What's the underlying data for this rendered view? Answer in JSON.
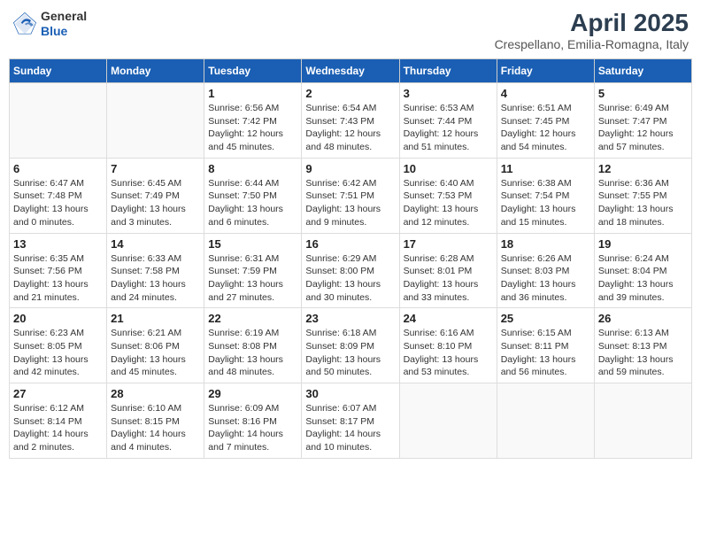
{
  "header": {
    "logo_general": "General",
    "logo_blue": "Blue",
    "title": "April 2025",
    "subtitle": "Crespellano, Emilia-Romagna, Italy"
  },
  "weekdays": [
    "Sunday",
    "Monday",
    "Tuesday",
    "Wednesday",
    "Thursday",
    "Friday",
    "Saturday"
  ],
  "weeks": [
    [
      {
        "day": null
      },
      {
        "day": null
      },
      {
        "day": "1",
        "sunrise": "Sunrise: 6:56 AM",
        "sunset": "Sunset: 7:42 PM",
        "daylight": "Daylight: 12 hours and 45 minutes."
      },
      {
        "day": "2",
        "sunrise": "Sunrise: 6:54 AM",
        "sunset": "Sunset: 7:43 PM",
        "daylight": "Daylight: 12 hours and 48 minutes."
      },
      {
        "day": "3",
        "sunrise": "Sunrise: 6:53 AM",
        "sunset": "Sunset: 7:44 PM",
        "daylight": "Daylight: 12 hours and 51 minutes."
      },
      {
        "day": "4",
        "sunrise": "Sunrise: 6:51 AM",
        "sunset": "Sunset: 7:45 PM",
        "daylight": "Daylight: 12 hours and 54 minutes."
      },
      {
        "day": "5",
        "sunrise": "Sunrise: 6:49 AM",
        "sunset": "Sunset: 7:47 PM",
        "daylight": "Daylight: 12 hours and 57 minutes."
      }
    ],
    [
      {
        "day": "6",
        "sunrise": "Sunrise: 6:47 AM",
        "sunset": "Sunset: 7:48 PM",
        "daylight": "Daylight: 13 hours and 0 minutes."
      },
      {
        "day": "7",
        "sunrise": "Sunrise: 6:45 AM",
        "sunset": "Sunset: 7:49 PM",
        "daylight": "Daylight: 13 hours and 3 minutes."
      },
      {
        "day": "8",
        "sunrise": "Sunrise: 6:44 AM",
        "sunset": "Sunset: 7:50 PM",
        "daylight": "Daylight: 13 hours and 6 minutes."
      },
      {
        "day": "9",
        "sunrise": "Sunrise: 6:42 AM",
        "sunset": "Sunset: 7:51 PM",
        "daylight": "Daylight: 13 hours and 9 minutes."
      },
      {
        "day": "10",
        "sunrise": "Sunrise: 6:40 AM",
        "sunset": "Sunset: 7:53 PM",
        "daylight": "Daylight: 13 hours and 12 minutes."
      },
      {
        "day": "11",
        "sunrise": "Sunrise: 6:38 AM",
        "sunset": "Sunset: 7:54 PM",
        "daylight": "Daylight: 13 hours and 15 minutes."
      },
      {
        "day": "12",
        "sunrise": "Sunrise: 6:36 AM",
        "sunset": "Sunset: 7:55 PM",
        "daylight": "Daylight: 13 hours and 18 minutes."
      }
    ],
    [
      {
        "day": "13",
        "sunrise": "Sunrise: 6:35 AM",
        "sunset": "Sunset: 7:56 PM",
        "daylight": "Daylight: 13 hours and 21 minutes."
      },
      {
        "day": "14",
        "sunrise": "Sunrise: 6:33 AM",
        "sunset": "Sunset: 7:58 PM",
        "daylight": "Daylight: 13 hours and 24 minutes."
      },
      {
        "day": "15",
        "sunrise": "Sunrise: 6:31 AM",
        "sunset": "Sunset: 7:59 PM",
        "daylight": "Daylight: 13 hours and 27 minutes."
      },
      {
        "day": "16",
        "sunrise": "Sunrise: 6:29 AM",
        "sunset": "Sunset: 8:00 PM",
        "daylight": "Daylight: 13 hours and 30 minutes."
      },
      {
        "day": "17",
        "sunrise": "Sunrise: 6:28 AM",
        "sunset": "Sunset: 8:01 PM",
        "daylight": "Daylight: 13 hours and 33 minutes."
      },
      {
        "day": "18",
        "sunrise": "Sunrise: 6:26 AM",
        "sunset": "Sunset: 8:03 PM",
        "daylight": "Daylight: 13 hours and 36 minutes."
      },
      {
        "day": "19",
        "sunrise": "Sunrise: 6:24 AM",
        "sunset": "Sunset: 8:04 PM",
        "daylight": "Daylight: 13 hours and 39 minutes."
      }
    ],
    [
      {
        "day": "20",
        "sunrise": "Sunrise: 6:23 AM",
        "sunset": "Sunset: 8:05 PM",
        "daylight": "Daylight: 13 hours and 42 minutes."
      },
      {
        "day": "21",
        "sunrise": "Sunrise: 6:21 AM",
        "sunset": "Sunset: 8:06 PM",
        "daylight": "Daylight: 13 hours and 45 minutes."
      },
      {
        "day": "22",
        "sunrise": "Sunrise: 6:19 AM",
        "sunset": "Sunset: 8:08 PM",
        "daylight": "Daylight: 13 hours and 48 minutes."
      },
      {
        "day": "23",
        "sunrise": "Sunrise: 6:18 AM",
        "sunset": "Sunset: 8:09 PM",
        "daylight": "Daylight: 13 hours and 50 minutes."
      },
      {
        "day": "24",
        "sunrise": "Sunrise: 6:16 AM",
        "sunset": "Sunset: 8:10 PM",
        "daylight": "Daylight: 13 hours and 53 minutes."
      },
      {
        "day": "25",
        "sunrise": "Sunrise: 6:15 AM",
        "sunset": "Sunset: 8:11 PM",
        "daylight": "Daylight: 13 hours and 56 minutes."
      },
      {
        "day": "26",
        "sunrise": "Sunrise: 6:13 AM",
        "sunset": "Sunset: 8:13 PM",
        "daylight": "Daylight: 13 hours and 59 minutes."
      }
    ],
    [
      {
        "day": "27",
        "sunrise": "Sunrise: 6:12 AM",
        "sunset": "Sunset: 8:14 PM",
        "daylight": "Daylight: 14 hours and 2 minutes."
      },
      {
        "day": "28",
        "sunrise": "Sunrise: 6:10 AM",
        "sunset": "Sunset: 8:15 PM",
        "daylight": "Daylight: 14 hours and 4 minutes."
      },
      {
        "day": "29",
        "sunrise": "Sunrise: 6:09 AM",
        "sunset": "Sunset: 8:16 PM",
        "daylight": "Daylight: 14 hours and 7 minutes."
      },
      {
        "day": "30",
        "sunrise": "Sunrise: 6:07 AM",
        "sunset": "Sunset: 8:17 PM",
        "daylight": "Daylight: 14 hours and 10 minutes."
      },
      {
        "day": null
      },
      {
        "day": null
      },
      {
        "day": null
      }
    ]
  ]
}
